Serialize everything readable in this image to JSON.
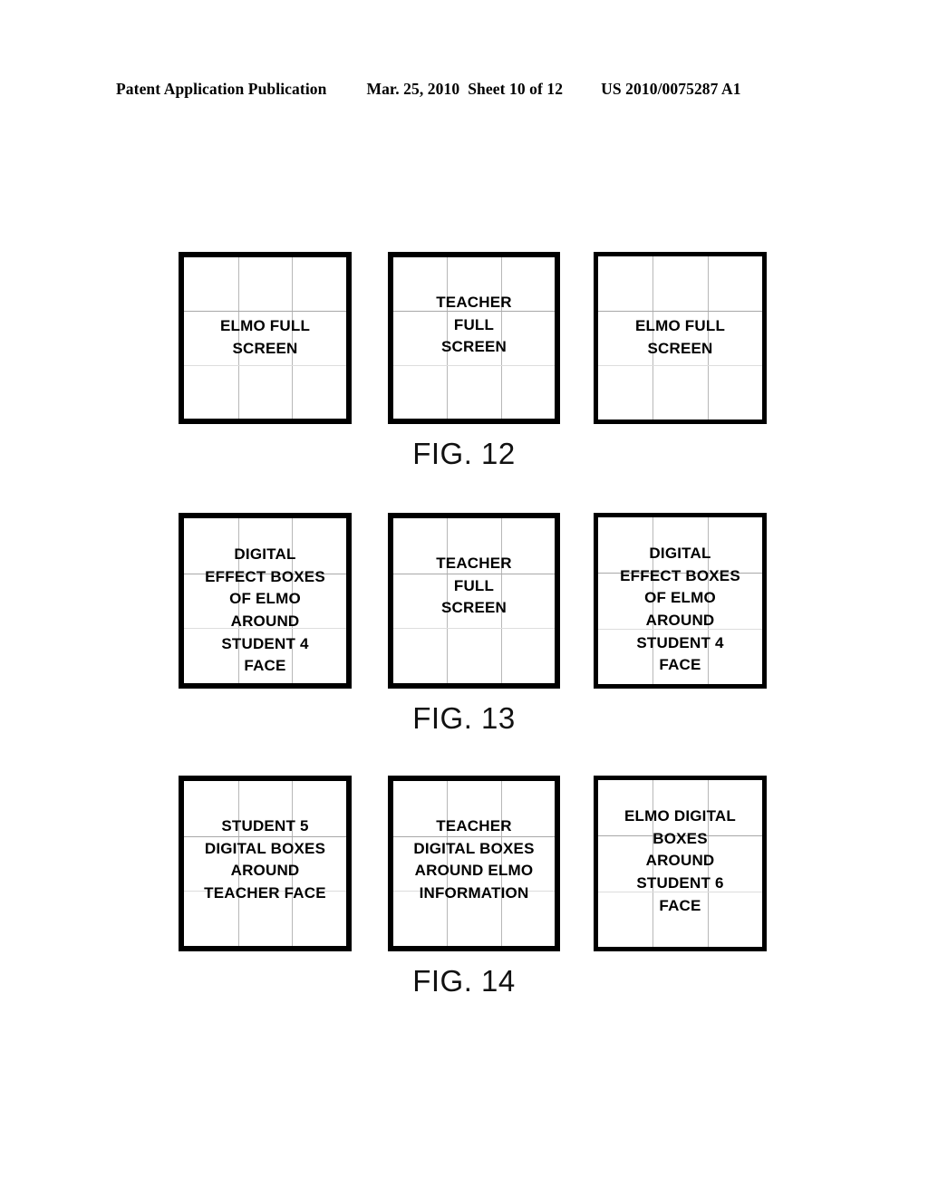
{
  "header": {
    "publication": "Patent Application Publication",
    "date": "Mar. 25, 2010",
    "sheet": "Sheet 10 of 12",
    "patent_number": "US 2010/0075287 A1"
  },
  "figures": [
    {
      "caption": "FIG. 12",
      "boxes": [
        {
          "id": "fig12-box-1",
          "lines": [
            "ELMO FULL",
            "SCREEN"
          ],
          "align": "center"
        },
        {
          "id": "fig12-box-2",
          "lines": [
            "TEACHER",
            "FULL",
            "SCREEN"
          ],
          "align": "shift-up-sm"
        },
        {
          "id": "fig12-box-3",
          "lines": [
            "ELMO FULL",
            "SCREEN"
          ],
          "align": "center"
        }
      ]
    },
    {
      "caption": "FIG. 13",
      "boxes": [
        {
          "id": "fig13-box-1",
          "lines": [
            "DIGITAL",
            "EFFECT BOXES",
            "OF ELMO",
            "AROUND",
            "STUDENT 4",
            "FACE"
          ],
          "align": "shift-up"
        },
        {
          "id": "fig13-box-2",
          "lines": [
            "TEACHER",
            "FULL",
            "SCREEN"
          ],
          "align": "shift-up-sm"
        },
        {
          "id": "fig13-box-3",
          "lines": [
            "DIGITAL",
            "EFFECT BOXES",
            "OF ELMO",
            "AROUND",
            "STUDENT 4",
            "FACE"
          ],
          "align": "shift-up"
        }
      ]
    },
    {
      "caption": "FIG. 14",
      "boxes": [
        {
          "id": "fig14-box-1",
          "lines": [
            "STUDENT 5",
            "DIGITAL BOXES",
            "AROUND",
            "TEACHER FACE"
          ],
          "align": "shift-up-sm"
        },
        {
          "id": "fig14-box-2",
          "lines": [
            "TEACHER",
            "DIGITAL BOXES",
            "AROUND ELMO",
            "INFORMATION"
          ],
          "align": "shift-up-sm"
        },
        {
          "id": "fig14-box-3",
          "lines": [
            "ELMO DIGITAL",
            "BOXES",
            "AROUND",
            "STUDENT 6",
            "FACE"
          ],
          "align": "shift-up"
        }
      ]
    }
  ],
  "colors": {
    "ink": "#000000",
    "page": "#ffffff",
    "grid_line": "#b8b8b8",
    "grid_line_faint": "#dddddd"
  }
}
